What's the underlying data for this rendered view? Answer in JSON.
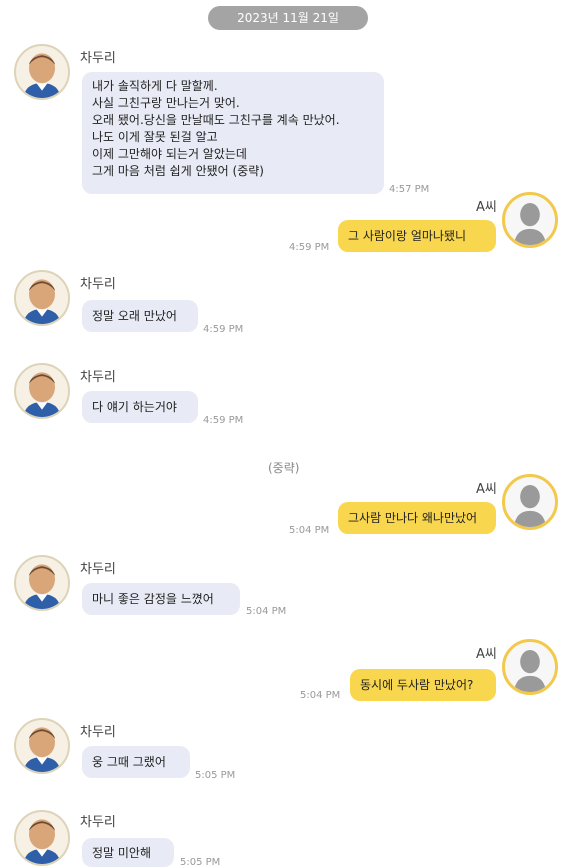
{
  "date_divider": "2023년 11월 21일",
  "sender_left": "차두리",
  "sender_right": "A씨",
  "system_note": "(중략)",
  "messages": [
    {
      "side": "left",
      "lines": [
        "내가 솔직하게 다 말할께.",
        "사실 그친구랑 만나는거 맞어.",
        "오래 됐어.당신을 만날때도 그친구를 계속 만났어.",
        "나도 이게 잘못 된걸 알고",
        "이제 그만해야 되는거 알았는데",
        "그게 마음 처럼 쉽게 안됐어 (중략)"
      ],
      "time": "4:57 PM"
    },
    {
      "side": "right",
      "text": "그 사람이랑 얼마나됐니",
      "time": "4:59 PM"
    },
    {
      "side": "left",
      "text": "정말 오래 만났어",
      "time": "4:59 PM"
    },
    {
      "side": "left",
      "text": "다 얘기 하는거야",
      "time": "4:59 PM"
    },
    {
      "side": "right",
      "text": "그사람 만나다 왜나만났어",
      "time": "5:04 PM"
    },
    {
      "side": "left",
      "text": "마니 좋은 감정을 느꼈어",
      "time": "5:04 PM"
    },
    {
      "side": "right",
      "text": "동시에 두사람 만났어?",
      "time": "5:04 PM"
    },
    {
      "side": "left",
      "text": "웅 그때 그랬어",
      "time": "5:05 PM"
    },
    {
      "side": "left",
      "text": "정말 미안해",
      "time": "5:05 PM"
    }
  ]
}
